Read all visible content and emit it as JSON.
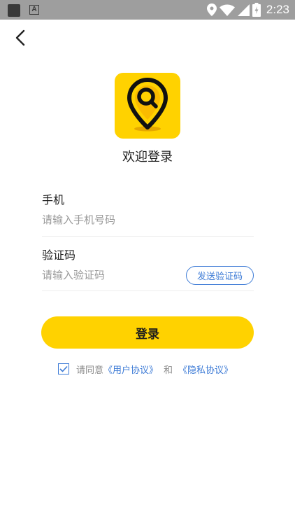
{
  "status_bar": {
    "time": "2:23",
    "a_glyph": "A"
  },
  "header": {
    "back_icon": "back-arrow-icon"
  },
  "brand": {
    "logo_icon": "map-pin-search-icon",
    "title": "欢迎登录"
  },
  "form": {
    "phone": {
      "label": "手机",
      "placeholder": "请输入手机号码",
      "value": ""
    },
    "code": {
      "label": "验证码",
      "placeholder": "请输入验证码",
      "value": "",
      "send_label": "发送验证码"
    }
  },
  "login_label": "登录",
  "agreement": {
    "checked": true,
    "prefix": "请同意",
    "user_agreement": "《用户协议》",
    "and": "和",
    "privacy": "《隐私协议》"
  },
  "colors": {
    "accent": "#ffd200",
    "link": "#3d7bd6",
    "status_bar": "#9e9e9e"
  }
}
